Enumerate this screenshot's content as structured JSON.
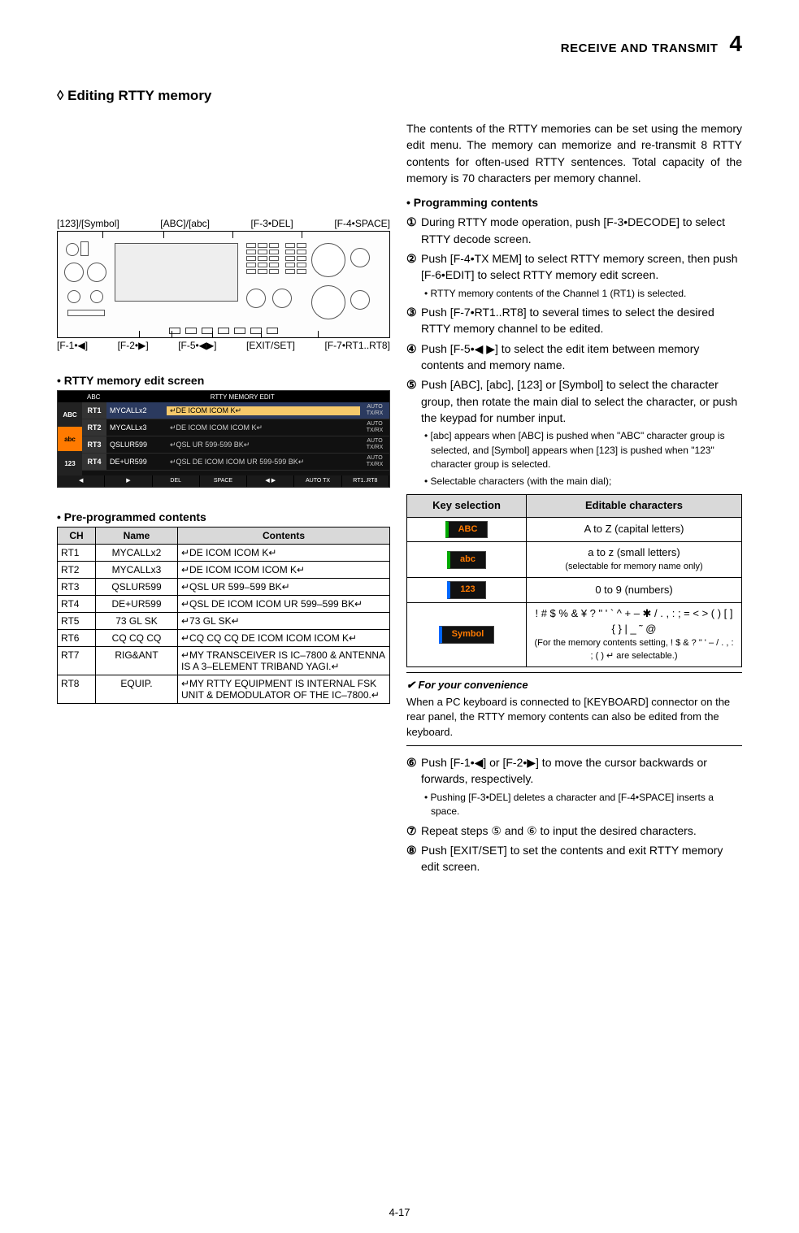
{
  "header": {
    "section": "RECEIVE AND TRANSMIT",
    "chapter": "4"
  },
  "section_title": "◊ Editing RTTY memory",
  "figure_labels": {
    "top": [
      "[123]/[Symbol]",
      "[ABC]/[abc]",
      "[F-3•DEL]",
      "[F-4•SPACE]"
    ],
    "bottom": [
      "[F-1•◀]",
      "[F-2•▶]",
      "[F-5•◀▶]",
      "[EXIT/SET]",
      "[F-7•RT1..RT8]"
    ]
  },
  "edit_screen": {
    "title": "• RTTY memory edit screen",
    "toptitle": "RTTY  MEMORY  EDIT",
    "left_tabs": [
      "ABC",
      "abc",
      "123"
    ],
    "rows": [
      {
        "tag": "RT1",
        "name": "MYCALLx2",
        "body": "↵DE  ICOM  ICOM  K↵",
        "flag": "AUTO\nTX/RX"
      },
      {
        "tag": "RT2",
        "name": "MYCALLx3",
        "body": "↵DE ICOM ICOM ICOM K↵",
        "flag": "AUTO\nTX/RX"
      },
      {
        "tag": "RT3",
        "name": "QSLUR599",
        "body": "↵QSL UR 599-599 BK↵",
        "flag": "AUTO\nTX/RX"
      },
      {
        "tag": "RT4",
        "name": "DE+UR599",
        "body": "↵QSL DE ICOM ICOM UR 599-599 BK↵",
        "flag": "AUTO\nTX/RX"
      }
    ],
    "bottom": [
      "◀",
      "▶",
      "DEL",
      "SPACE",
      "◀ ▶",
      "AUTO  TX",
      "RT1..RT8"
    ]
  },
  "pre_table": {
    "title": "• Pre-programmed contents",
    "headers": [
      "CH",
      "Name",
      "Contents"
    ],
    "rows": [
      [
        "RT1",
        "MYCALLx2",
        "↵DE ICOM ICOM K↵"
      ],
      [
        "RT2",
        "MYCALLx3",
        "↵DE ICOM ICOM ICOM K↵"
      ],
      [
        "RT3",
        "QSLUR599",
        "↵QSL UR 599–599 BK↵"
      ],
      [
        "RT4",
        "DE+UR599",
        "↵QSL DE ICOM ICOM UR 599–599 BK↵"
      ],
      [
        "RT5",
        "73 GL SK",
        "↵73 GL SK↵"
      ],
      [
        "RT6",
        "CQ CQ CQ",
        "↵CQ CQ CQ DE ICOM ICOM ICOM K↵"
      ],
      [
        "RT7",
        "RIG&ANT",
        "↵MY TRANSCEIVER IS IC–7800 & ANTENNA IS A 3–ELEMENT TRIBAND YAGI.↵"
      ],
      [
        "RT8",
        "EQUIP.",
        "↵MY RTTY EQUIPMENT IS INTERNAL FSK UNIT & DEMODULATOR OF THE IC–7800.↵"
      ]
    ]
  },
  "right": {
    "intro": "The contents of the RTTY memories can be set using the memory edit menu. The memory can memorize and re-transmit 8 RTTY contents for often-used RTTY sentences. Total capacity of the memory is 70 characters per memory channel.",
    "prog_title": "• Programming contents",
    "steps": [
      {
        "n": "①",
        "body": "During RTTY mode operation, push [F-3•DECODE] to select RTTY decode screen."
      },
      {
        "n": "②",
        "body": "Push [F-4•TX MEM] to select RTTY memory screen, then push [F-6•EDIT] to select RTTY memory edit screen.",
        "notes": [
          "• RTTY memory contents of the Channel 1 (RT1) is selected."
        ]
      },
      {
        "n": "③",
        "body": "Push [F-7•RT1..RT8] to several times to select the desired RTTY memory channel to be edited."
      },
      {
        "n": "④",
        "body": "Push [F-5•◀ ▶] to select the edit item between memory contents and memory name."
      },
      {
        "n": "⑤",
        "body": "Push [ABC], [abc], [123] or [Symbol] to select the character group, then rotate the main dial to select the character, or push the keypad for number input.",
        "notes": [
          "• [abc] appears when [ABC] is pushed when \"ABC\" character group is selected, and [Symbol] appears when [123] is pushed when \"123\" character group is selected.",
          "• Selectable characters (with the main dial);"
        ]
      }
    ],
    "char_table": {
      "headers": [
        "Key selection",
        "Editable characters"
      ],
      "rows": [
        {
          "key": "ABC",
          "pillClass": "",
          "body": "A to Z (capital letters)",
          "sub": ""
        },
        {
          "key": "abc",
          "pillClass": "",
          "body": "a to z (small letters)",
          "sub": "(selectable for memory name only)"
        },
        {
          "key": "123",
          "pillClass": "blue",
          "body": "0 to 9 (numbers)",
          "sub": ""
        },
        {
          "key": "Symbol",
          "pillClass": "blue",
          "body": "! # $ % & ¥ ? \" ' ` ^ + – ✱ / . , : ; = < > ( ) [ ] { } | _ ˜ @",
          "sub": "(For the memory contents setting, ! $ & ? \" ' – / . , : ; ( ) ↵ are selectable.)"
        }
      ]
    },
    "convenience": {
      "title": "✔ For your convenience",
      "body": "When a PC keyboard is connected to [KEYBOARD] connector on the rear panel, the RTTY memory contents can also be edited from the keyboard."
    },
    "steps_after": [
      {
        "n": "⑥",
        "body": "Push [F-1•◀] or [F-2•▶] to move the cursor backwards or forwards, respectively.",
        "notes": [
          "• Pushing [F-3•DEL] deletes a character and [F-4•SPACE] inserts a space."
        ]
      },
      {
        "n": "⑦",
        "body": "Repeat steps ⑤ and ⑥ to input the desired characters."
      },
      {
        "n": "⑧",
        "body": "Push [EXIT/SET] to set the contents and exit RTTY memory edit screen."
      }
    ]
  },
  "page_number": "4-17"
}
